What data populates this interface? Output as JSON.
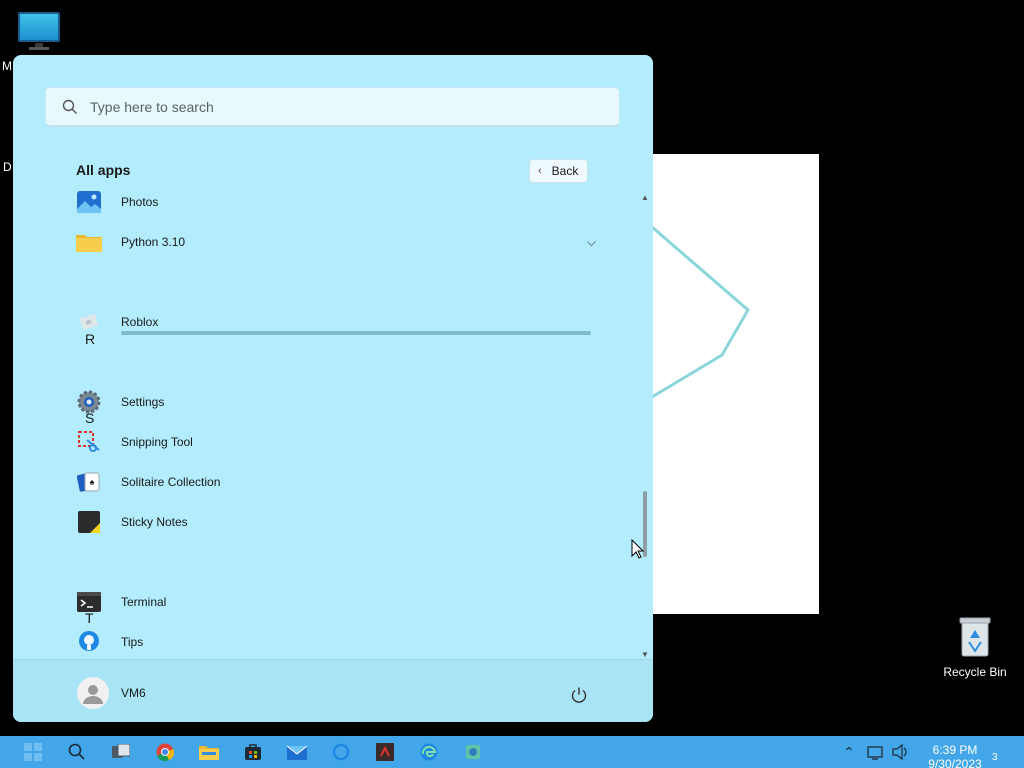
{
  "desktop": {
    "icons": [
      {
        "name": "monitor-icon",
        "label": "M"
      },
      {
        "name": "recycle-bin",
        "label": "Recycle Bin"
      }
    ],
    "edge_label": "D"
  },
  "start_menu": {
    "search": {
      "placeholder": "Type here to search"
    },
    "all_apps_title": "All apps",
    "back_label": "Back",
    "items": [
      {
        "type": "app",
        "label": "Photos",
        "icon": "photos-icon"
      },
      {
        "type": "app",
        "label": "Python 3.10",
        "icon": "folder-icon",
        "expandable": true
      },
      {
        "type": "letter",
        "label": "R"
      },
      {
        "type": "app",
        "label": "Roblox",
        "icon": "roblox-icon",
        "installing": true
      },
      {
        "type": "letter",
        "label": "S"
      },
      {
        "type": "app",
        "label": "Settings",
        "icon": "settings-icon"
      },
      {
        "type": "app",
        "label": "Snipping Tool",
        "icon": "snipping-tool-icon"
      },
      {
        "type": "app",
        "label": "Solitaire Collection",
        "icon": "solitaire-icon"
      },
      {
        "type": "app",
        "label": "Sticky Notes",
        "icon": "sticky-notes-icon"
      },
      {
        "type": "letter",
        "label": "T"
      },
      {
        "type": "app",
        "label": "Terminal",
        "icon": "terminal-icon"
      },
      {
        "type": "app",
        "label": "Tips",
        "icon": "tips-icon"
      }
    ],
    "user": {
      "name": "VM6"
    }
  },
  "taskbar": {
    "apps": [
      "start-icon",
      "search-icon",
      "task-view-icon",
      "chrome-icon",
      "file-explorer-icon",
      "store-icon",
      "mail-icon",
      "cortana-icon",
      "app-icon",
      "edge-icon",
      "settings-app-icon"
    ],
    "clock": {
      "time": "6:39 PM",
      "date": "9/30/2023"
    },
    "notification_count": "3"
  },
  "colors": {
    "start_bg": "#b3ecfc",
    "taskbar_bg": "#43a6e8",
    "accent": "#0067c0"
  }
}
